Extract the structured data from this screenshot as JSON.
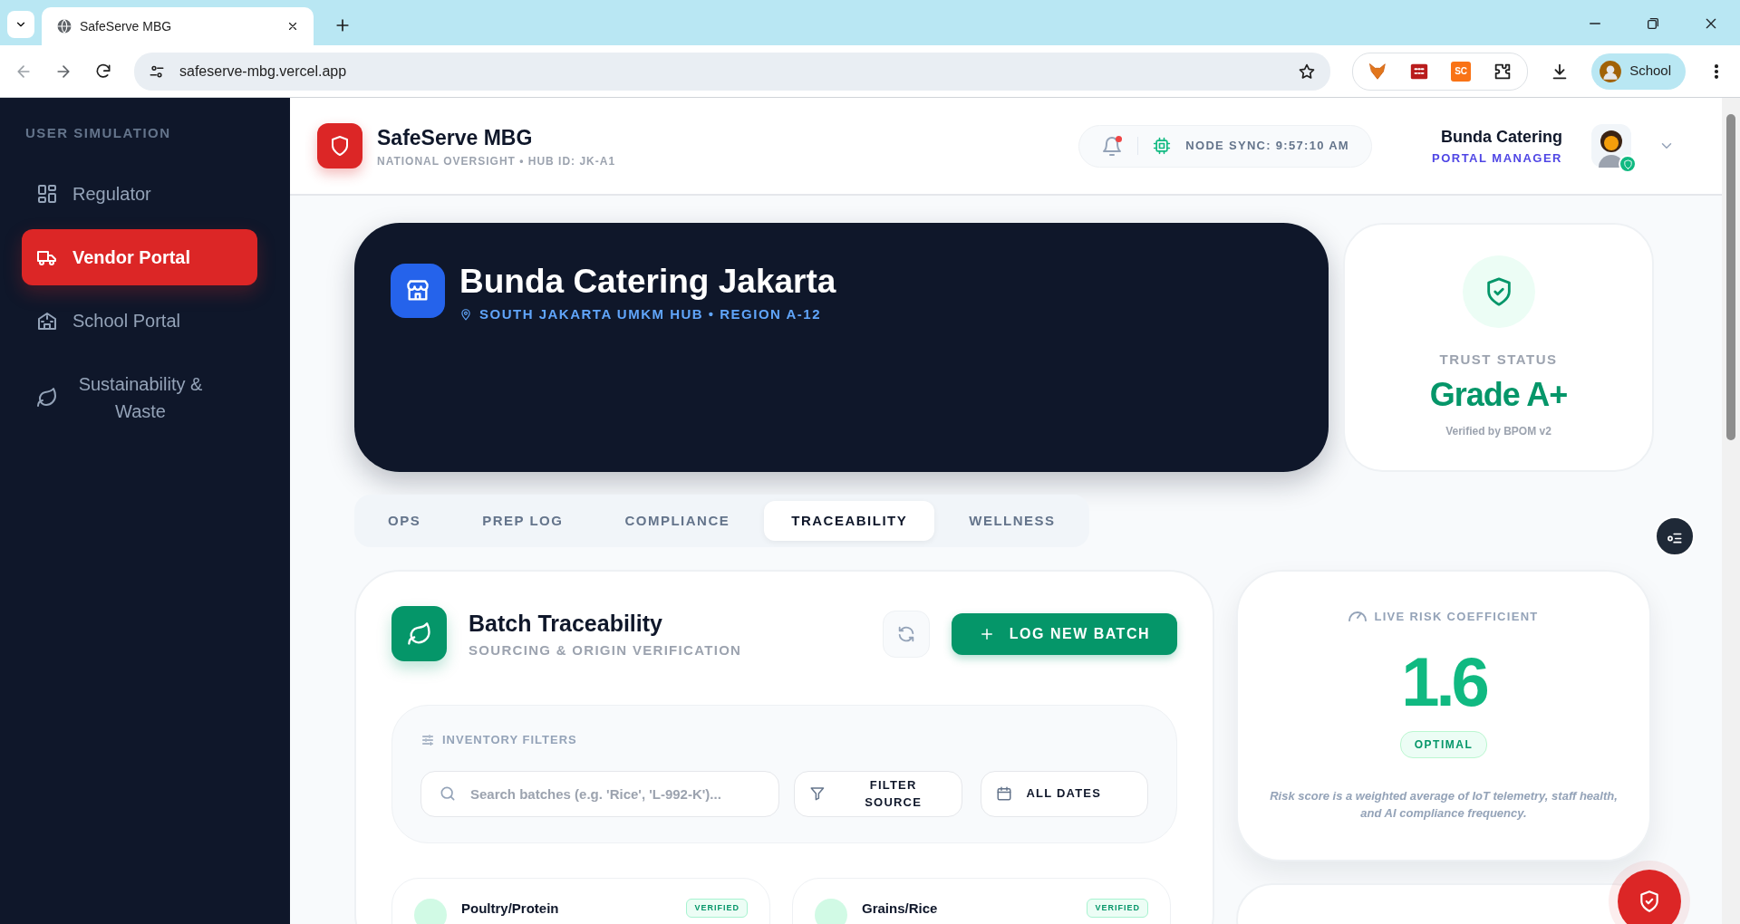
{
  "browser": {
    "tab_title": "SafeServe MBG",
    "url": "safeserve-mbg.vercel.app",
    "extension_label": "SC",
    "profile": "School"
  },
  "sidebar": {
    "heading": "USER SIMULATION",
    "items": [
      {
        "label": "Regulator",
        "selected": false
      },
      {
        "label": "Vendor Portal",
        "selected": true
      },
      {
        "label": "School Portal",
        "selected": false
      },
      {
        "label": "Sustainability & Waste",
        "selected": false
      }
    ]
  },
  "header": {
    "app_name": "SafeServe MBG",
    "subtitle": "NATIONAL OVERSIGHT • HUB ID: JK-A1",
    "notification_unread": true,
    "sync": "NODE SYNC: 9:57:10 AM",
    "user_name": "Bunda Catering",
    "user_role": "PORTAL MANAGER"
  },
  "hero": {
    "title": "Bunda Catering Jakarta",
    "location": "SOUTH JAKARTA UMKM HUB • REGION A-12"
  },
  "trust": {
    "label": "TRUST STATUS",
    "grade": "Grade A+",
    "note": "Verified by BPOM v2"
  },
  "tabs": [
    {
      "label": "OPS",
      "selected": false
    },
    {
      "label": "PREP LOG",
      "selected": false
    },
    {
      "label": "COMPLIANCE",
      "selected": false
    },
    {
      "label": "TRACEABILITY",
      "selected": true
    },
    {
      "label": "WELLNESS",
      "selected": false
    }
  ],
  "batch_panel": {
    "title": "Batch Traceability",
    "subtitle": "SOURCING & ORIGIN VERIFICATION",
    "add_button": "LOG NEW BATCH",
    "filters_label": "INVENTORY FILTERS",
    "search": {
      "placeholder": "Search batches (e.g. 'Rice', 'L-992-K')..."
    },
    "filter_source": "FILTER SOURCE",
    "date_filter": "ALL DATES",
    "batches": [
      {
        "category": "Poultry/Protein",
        "status": "VERIFIED"
      },
      {
        "category": "Grains/Rice",
        "status": "VERIFIED"
      }
    ]
  },
  "risk": {
    "label": "LIVE RISK COEFFICIENT",
    "score": "1.6",
    "status": "OPTIMAL",
    "note": "Risk score is a weighted average of IoT telemetry, staff health, and AI compliance frequency."
  }
}
